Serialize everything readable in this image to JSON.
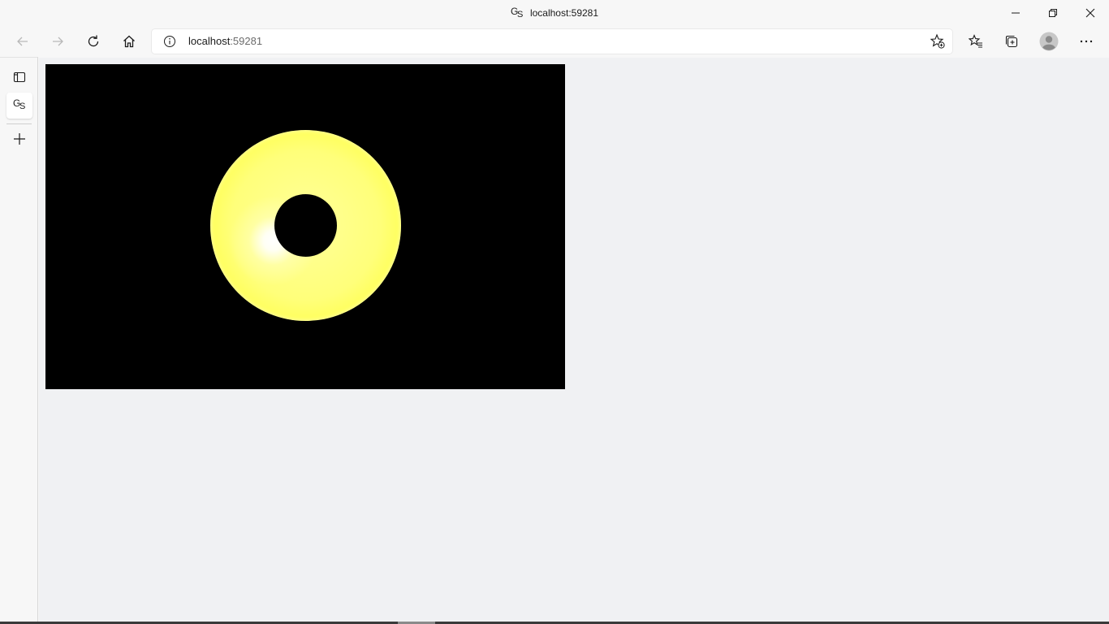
{
  "window": {
    "favicon": "GS",
    "favicon_g": "G",
    "favicon_s": "S",
    "title": "localhost:59281"
  },
  "toolbar": {
    "address_host": "localhost",
    "address_port": ":59281",
    "icons": [
      "back-icon",
      "forward-icon",
      "refresh-icon",
      "home-icon",
      "info-icon",
      "add-favorite-icon",
      "favorites-icon",
      "collections-icon",
      "profile-icon",
      "more-icon"
    ]
  },
  "tabs": {
    "active_tab_icon": "GS",
    "icons": [
      "tab-actions-icon",
      "new-tab-icon"
    ]
  },
  "scene": {
    "background": "#000000",
    "object": "torus",
    "object_color": "#ffff7a"
  }
}
